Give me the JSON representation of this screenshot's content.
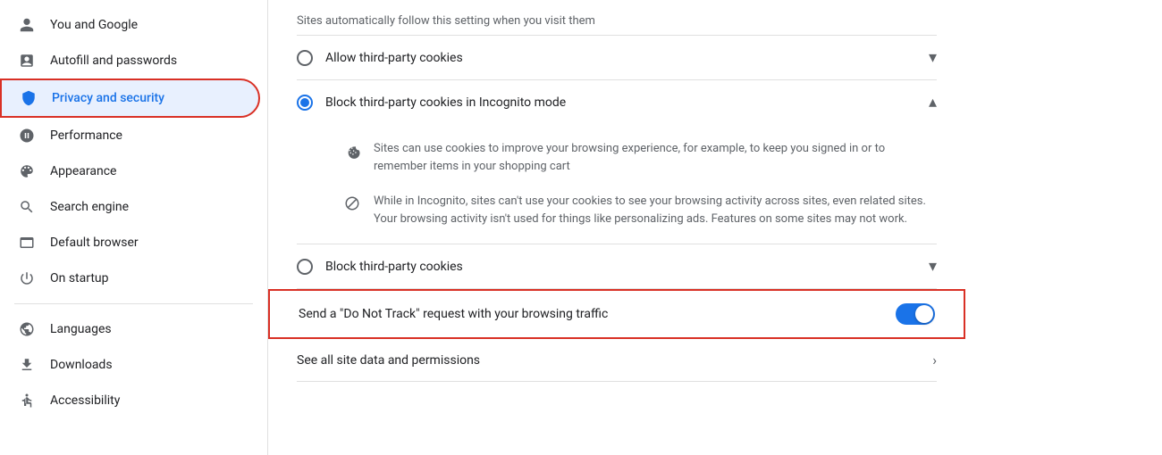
{
  "sidebar": {
    "items": [
      {
        "id": "you-and-google",
        "label": "You and Google",
        "icon": "person",
        "active": false
      },
      {
        "id": "autofill",
        "label": "Autofill and passwords",
        "icon": "assignment",
        "active": false
      },
      {
        "id": "privacy",
        "label": "Privacy and security",
        "icon": "shield",
        "active": true
      },
      {
        "id": "performance",
        "label": "Performance",
        "icon": "speed",
        "active": false
      },
      {
        "id": "appearance",
        "label": "Appearance",
        "icon": "palette",
        "active": false
      },
      {
        "id": "search-engine",
        "label": "Search engine",
        "icon": "search",
        "active": false
      },
      {
        "id": "default-browser",
        "label": "Default browser",
        "icon": "browser",
        "active": false
      },
      {
        "id": "on-startup",
        "label": "On startup",
        "icon": "power",
        "active": false
      }
    ],
    "divider": true,
    "items2": [
      {
        "id": "languages",
        "label": "Languages",
        "icon": "globe",
        "active": false
      },
      {
        "id": "downloads",
        "label": "Downloads",
        "icon": "download",
        "active": false
      },
      {
        "id": "accessibility",
        "label": "Accessibility",
        "icon": "accessibility",
        "active": false
      }
    ]
  },
  "main": {
    "top_description": "Sites automatically follow this setting when you visit them",
    "options": [
      {
        "id": "allow-third-party",
        "label": "Allow third-party cookies",
        "checked": false,
        "expanded": false,
        "chevron": "▾"
      },
      {
        "id": "block-incognito",
        "label": "Block third-party cookies in Incognito mode",
        "checked": true,
        "expanded": true,
        "chevron": "▴"
      },
      {
        "id": "block-all",
        "label": "Block third-party cookies",
        "checked": false,
        "expanded": false,
        "chevron": "▾"
      }
    ],
    "expanded_items": [
      {
        "icon": "cookie",
        "text": "Sites can use cookies to improve your browsing experience, for example, to keep you signed in or to remember items in your shopping cart"
      },
      {
        "icon": "block",
        "text": "While in Incognito, sites can't use your cookies to see your browsing activity across sites, even related sites. Your browsing activity isn't used for things like personalizing ads. Features on some sites may not work."
      }
    ],
    "dnt": {
      "label": "Send a \"Do Not Track\" request with your browsing traffic",
      "enabled": true
    },
    "site_data": {
      "label": "See all site data and permissions",
      "arrow": "›"
    }
  }
}
